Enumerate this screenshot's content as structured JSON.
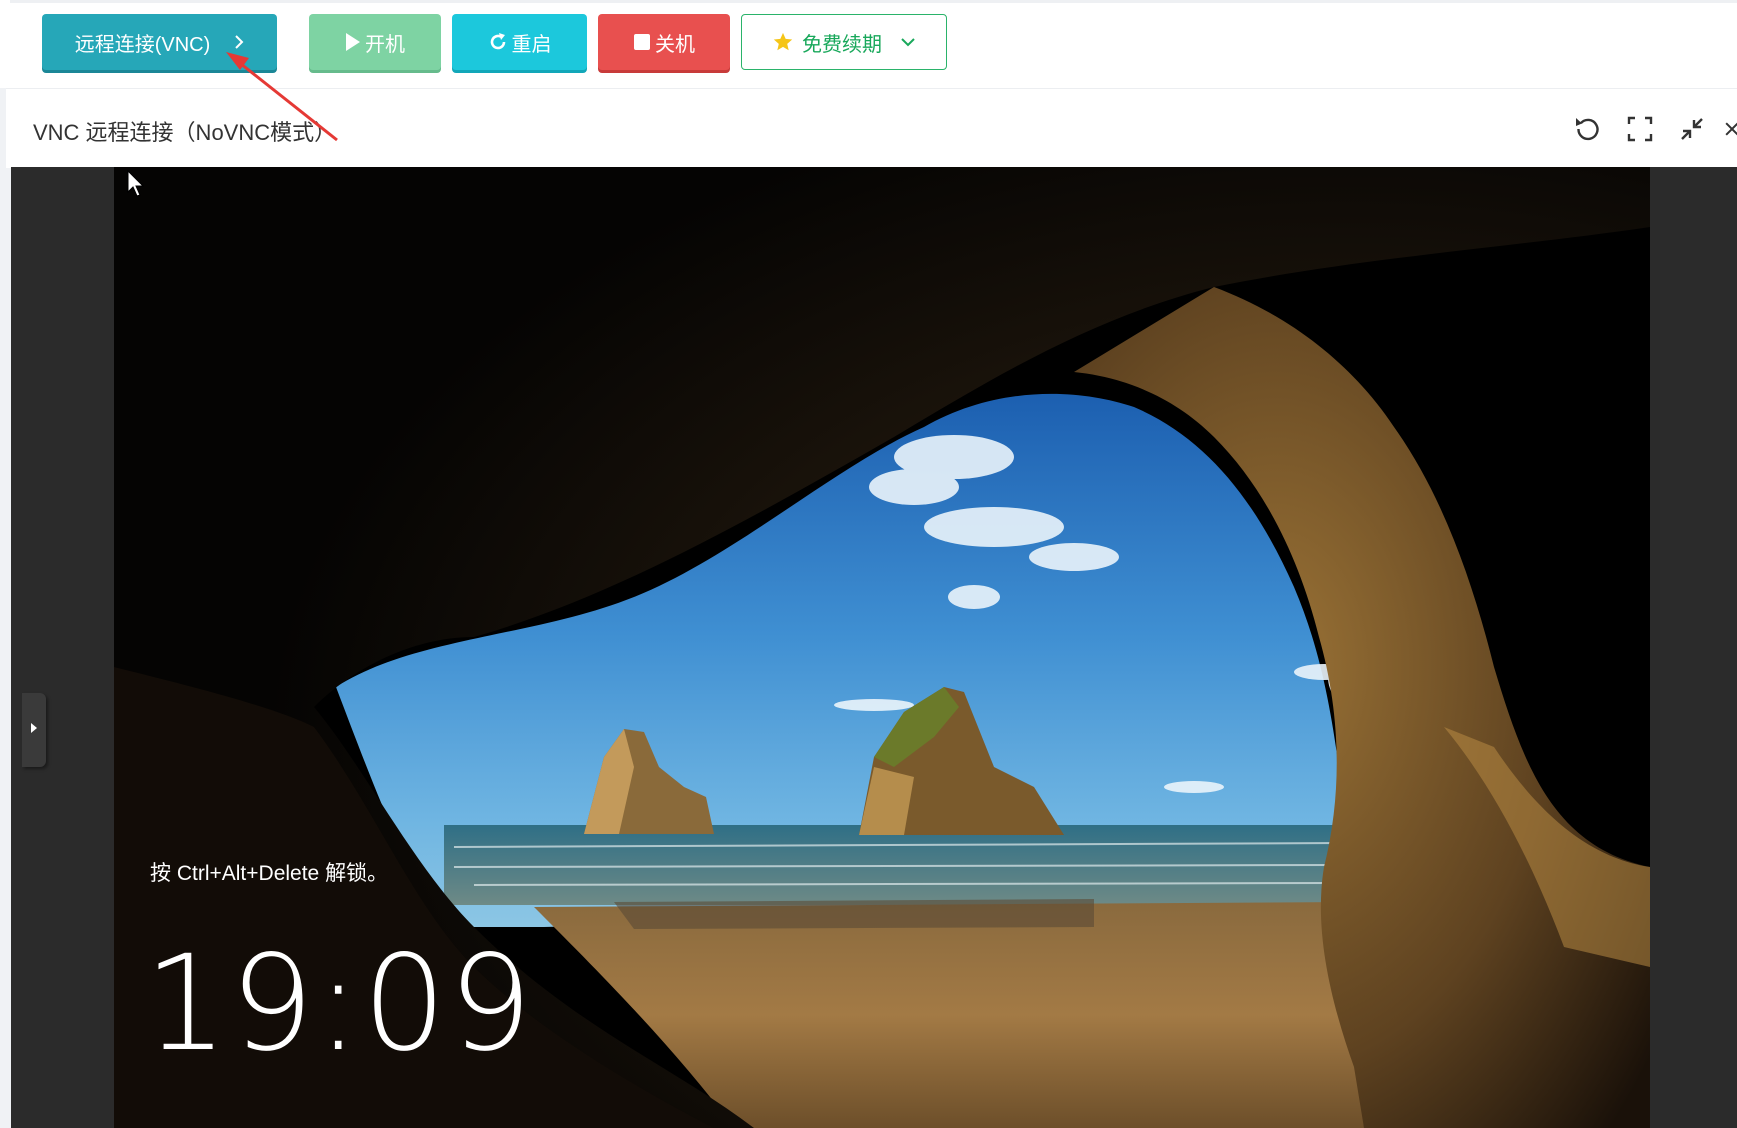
{
  "toolbar": {
    "vnc_label": "远程连接(VNC)",
    "start_label": "开机",
    "restart_label": "重启",
    "shutdown_label": "关机",
    "renew_label": "免费续期"
  },
  "panel": {
    "title": "VNC 远程连接（NoVNC模式）"
  },
  "lockscreen": {
    "hint": "按 Ctrl+Alt+Delete 解锁。",
    "time": "19:09"
  },
  "colors": {
    "vnc": "#26a7b8",
    "start": "#7ed3a3",
    "restart": "#1cc8dc",
    "shutdown": "#e8504f",
    "renew": "#19a85b",
    "annotation_arrow": "#e53935"
  },
  "icons": {
    "vnc_button": "chevron-right-icon",
    "start_button": "play-icon",
    "restart_button": "refresh-icon",
    "shutdown_button": "stop-icon",
    "renew_button": [
      "star-icon",
      "chevron-down-icon"
    ],
    "panel_header": [
      "reload-icon",
      "fullscreen-icon",
      "minimize-icon",
      "close-icon"
    ],
    "vnc_side": "expand-handle-icon"
  }
}
